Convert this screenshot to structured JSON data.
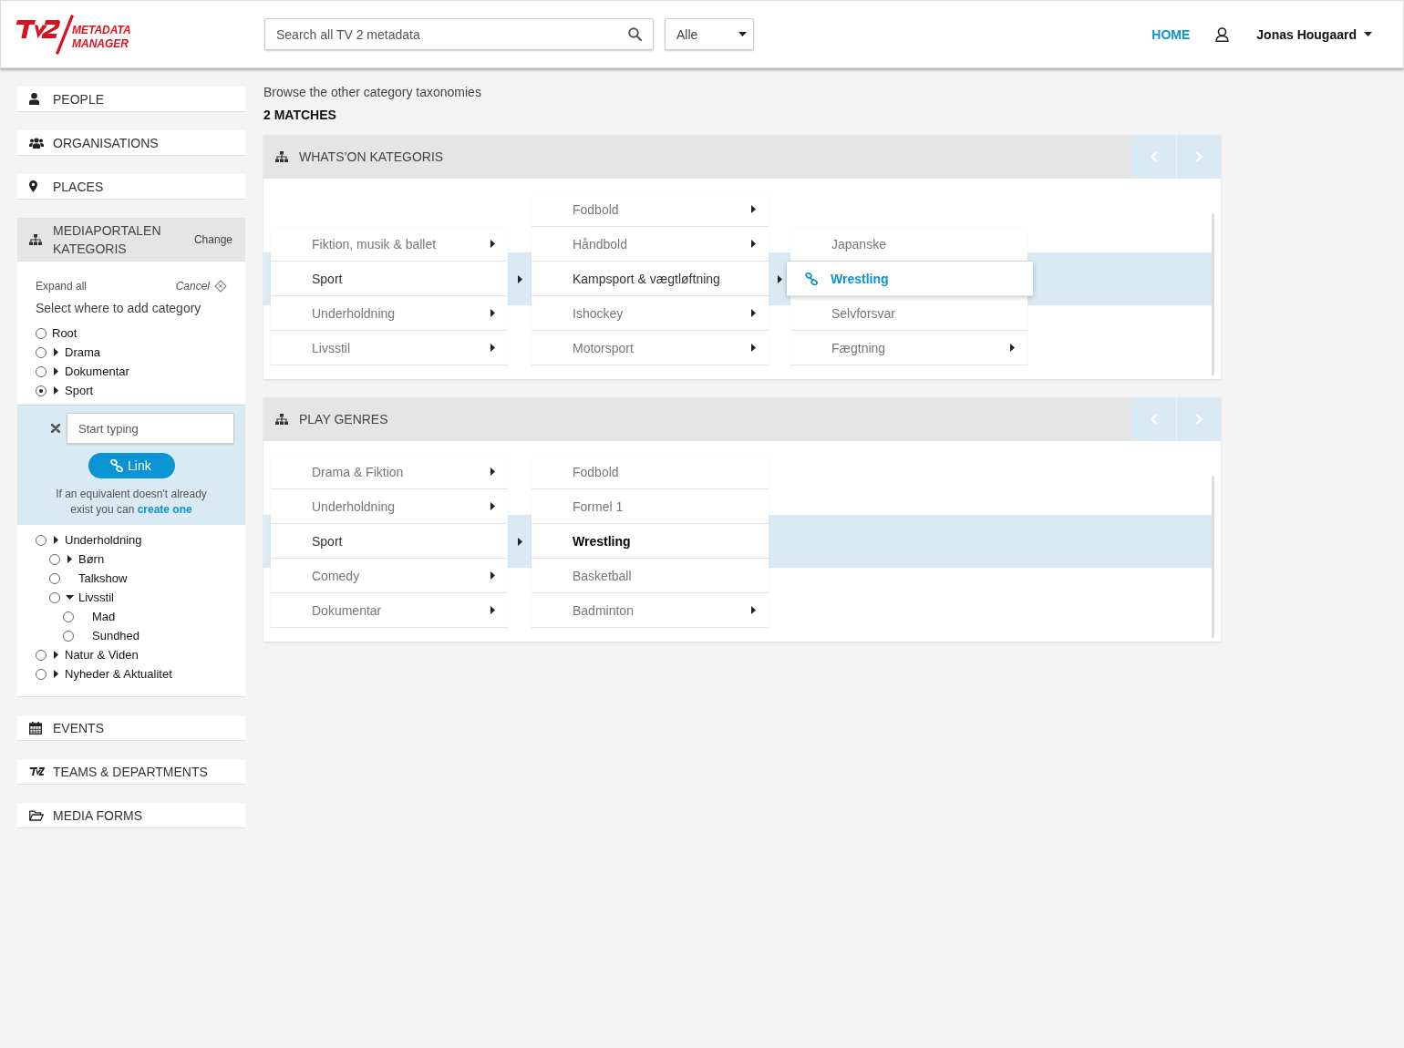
{
  "header": {
    "logo_lines": [
      "METADATA",
      "MANAGER"
    ],
    "search": {
      "placeholder": "Search all TV 2 metadata"
    },
    "filter": {
      "value": "Alle"
    },
    "nav": [
      {
        "label": "HOME",
        "selected": true
      }
    ],
    "user": {
      "name": "Jonas Hougaard"
    }
  },
  "sidebar": {
    "items": [
      {
        "label": "PEOPLE",
        "expanded": false
      },
      {
        "label": "ORGANISATIONS",
        "expanded": false
      },
      {
        "label": "PLACES",
        "expanded": false
      },
      {
        "label": "MEDIAPORTALEN KATEGORIS",
        "expanded": true,
        "action": "Change",
        "expand_all": "Expand all",
        "cancel": "Cancel",
        "prompt": "Select where to add category",
        "tree": [
          {
            "kind": "root",
            "label": "Root",
            "selected": false
          },
          {
            "kind": "node",
            "label": "Drama",
            "has_children": true,
            "expanded": false,
            "selected": false
          },
          {
            "kind": "node",
            "label": "Dokumentar",
            "has_children": true,
            "expanded": false,
            "selected": false
          },
          {
            "kind": "node",
            "label": "Sport",
            "has_children": true,
            "expanded": false,
            "selected": true
          },
          {
            "kind": "node",
            "label": "Underholdning",
            "has_children": true,
            "expanded": false,
            "selected": false,
            "children": [
              {
                "kind": "node",
                "label": "Børn",
                "has_children": true,
                "expanded": false,
                "selected": false
              },
              {
                "kind": "node",
                "label": "Talkshow",
                "has_children": false,
                "selected": false
              },
              {
                "kind": "node",
                "label": "Livsstil",
                "has_children": true,
                "expanded": true,
                "selected": false,
                "children": [
                  {
                    "kind": "node",
                    "label": "Mad",
                    "has_children": false,
                    "selected": false
                  },
                  {
                    "kind": "node",
                    "label": "Sundhed",
                    "has_children": false,
                    "selected": false
                  }
                ]
              }
            ]
          },
          {
            "kind": "node",
            "label": "Natur & Viden",
            "has_children": true,
            "expanded": false,
            "selected": false
          },
          {
            "kind": "node",
            "label": "Nyheder & Aktualitet",
            "has_children": true,
            "expanded": false,
            "selected": false
          }
        ],
        "add_form": {
          "placeholder": "Start typing",
          "button": "Link",
          "help": "If an equivalent doesn't already exist you can",
          "help_link": "create one"
        }
      },
      {
        "label": "EVENTS",
        "expanded": false
      },
      {
        "label": "TEAMS & DEPARTMENTS",
        "expanded": false
      },
      {
        "label": "MEDIA FORMS",
        "expanded": false
      }
    ]
  },
  "content": {
    "intro": "Browse the other category taxonomies",
    "matches": "2 MATCHES",
    "panels": [
      {
        "title": "WHATS’ON KATEGORIS",
        "columns": [
          {
            "items": [
              {
                "label": "Fiktion, musik & ballet",
                "has_children": true,
                "selected": false
              },
              {
                "label": "Sport",
                "has_children": true,
                "selected": true
              },
              {
                "label": "Underholdning",
                "has_children": true,
                "selected": false
              },
              {
                "label": "Livsstil",
                "has_children": true,
                "selected": false
              }
            ]
          },
          {
            "items": [
              {
                "label": "Fodbold",
                "has_children": true,
                "selected": false
              },
              {
                "label": "Håndbold",
                "has_children": true,
                "selected": false
              },
              {
                "label": "Kampsport & vægtløftning",
                "has_children": true,
                "selected": true
              },
              {
                "label": "Ishockey",
                "has_children": true,
                "selected": false
              },
              {
                "label": "Motorsport",
                "has_children": true,
                "selected": false
              }
            ]
          },
          {
            "items": [
              {
                "label": "Japanske",
                "has_children": false,
                "selected": false
              },
              {
                "label": "Wrestling",
                "kind": "link",
                "has_children": false,
                "selected": true
              },
              {
                "label": "Selvforsvar",
                "has_children": false,
                "selected": false
              },
              {
                "label": "Fægtning",
                "has_children": true,
                "selected": false
              }
            ]
          }
        ]
      },
      {
        "title": "PLAY GENRES",
        "columns": [
          {
            "items": [
              {
                "label": "Drama & Fiktion",
                "has_children": true,
                "selected": false
              },
              {
                "label": "Underholdning",
                "has_children": true,
                "selected": false
              },
              {
                "label": "Sport",
                "has_children": true,
                "selected": true
              },
              {
                "label": "Comedy",
                "has_children": true,
                "selected": false
              },
              {
                "label": "Dokumentar",
                "has_children": true,
                "selected": false
              }
            ]
          },
          {
            "items": [
              {
                "label": "Fodbold",
                "has_children": false,
                "selected": false
              },
              {
                "label": "Formel 1",
                "has_children": false,
                "selected": false
              },
              {
                "label": "Wrestling",
                "has_children": false,
                "selected": true
              },
              {
                "label": "Basketball",
                "has_children": false,
                "selected": false
              },
              {
                "label": "Badminton",
                "has_children": true,
                "selected": false
              }
            ]
          }
        ]
      }
    ]
  }
}
